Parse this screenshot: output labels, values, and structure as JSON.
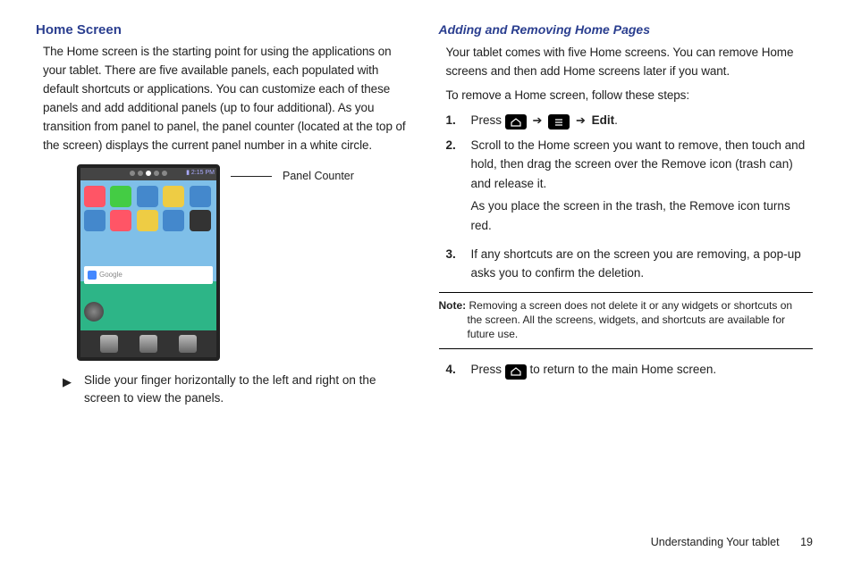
{
  "left": {
    "title": "Home Screen",
    "intro": "The Home screen is the starting point for using the applications on your tablet. There are five available panels, each populated with default shortcuts or applications. You can customize each of these panels and add additional panels (up to four additional). As you transition from panel to panel, the panel counter (located at the top of the screen) displays the current panel number in a white circle.",
    "callout_label": "Panel Counter",
    "search_placeholder": "Google",
    "bullet": "Slide your finger horizontally to the left and right on the screen to view the panels."
  },
  "right": {
    "title": "Adding and Removing Home Pages",
    "p1": "Your tablet comes with five Home screens. You can remove Home screens and then add Home screens later if you want.",
    "p2": "To remove a Home screen, follow these steps:",
    "step1_a": "Press ",
    "step1_arrow": "➔",
    "step1_edit": "Edit",
    "step1_period": ".",
    "step2_a": "Scroll to the Home screen you want to remove, then touch and hold, then drag the screen over the Remove icon (trash can) and release it.",
    "step2_b": "As you place the screen in the trash, the Remove icon turns red.",
    "step3": "If any shortcuts are on the screen you are removing, a pop-up asks you to confirm the deletion.",
    "note_label": "Note:",
    "note_first": " Removing a screen does not delete it or any widgets or shortcuts on",
    "note_rest": "the screen. All the screens, widgets, and shortcuts are available for future use.",
    "step4_a": "Press ",
    "step4_b": " to return to the main Home screen."
  },
  "footer": {
    "section": "Understanding Your tablet",
    "page": "19"
  },
  "nums": {
    "n1": "1.",
    "n2": "2.",
    "n3": "3.",
    "n4": "4."
  }
}
